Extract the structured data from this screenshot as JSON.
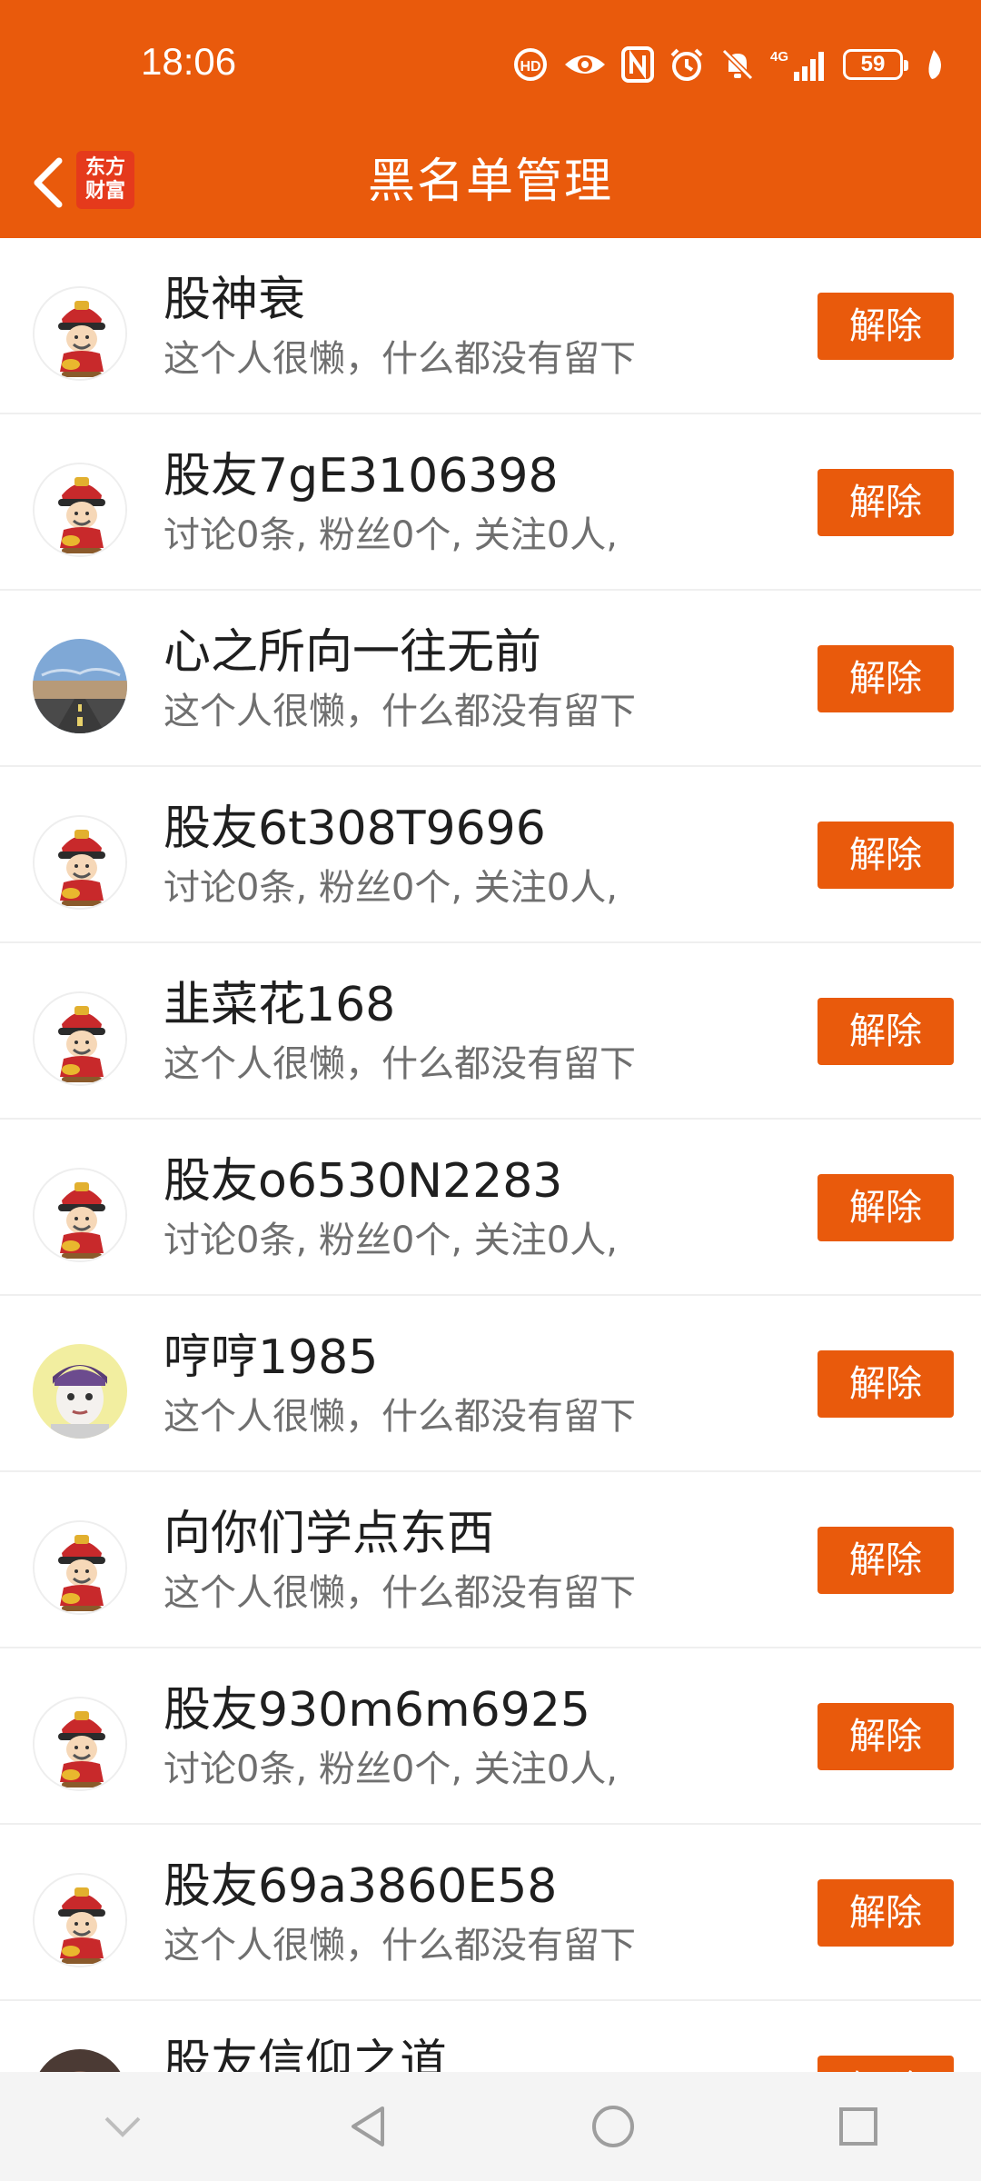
{
  "status_bar": {
    "time": "18:06",
    "battery": "59",
    "icons": [
      "hd-icon",
      "eye-icon",
      "nfc-icon",
      "alarm-icon",
      "mute-icon",
      "signal-4g-icon",
      "battery-icon",
      "leaf-icon"
    ]
  },
  "header": {
    "title": "黑名单管理",
    "logo_line1": "东方",
    "logo_line2": "财富",
    "back_icon": "chevron-left-icon"
  },
  "colors": {
    "brand": "#E95A0C",
    "divider": "#EFEFEF"
  },
  "button_label": "解除",
  "users": [
    {
      "name": "股神衰",
      "desc": "这个人很懒，什么都没有留下",
      "avatar": "caishen-avatar"
    },
    {
      "name": "股友7gE3106398",
      "desc": "讨论0条, 粉丝0个, 关注0人,",
      "avatar": "caishen-avatar"
    },
    {
      "name": "心之所向一往无前",
      "desc": "这个人很懒，什么都没有留下",
      "avatar": "road-photo-avatar"
    },
    {
      "name": "股友6t308T9696",
      "desc": "讨论0条, 粉丝0个, 关注0人,",
      "avatar": "caishen-avatar"
    },
    {
      "name": "韭菜花168",
      "desc": "这个人很懒，什么都没有留下",
      "avatar": "caishen-avatar"
    },
    {
      "name": "股友o6530N2283",
      "desc": "讨论0条, 粉丝0个, 关注0人,",
      "avatar": "caishen-avatar"
    },
    {
      "name": "哼哼1985",
      "desc": "这个人很懒，什么都没有留下",
      "avatar": "cartoon-boy-avatar"
    },
    {
      "name": "向你们学点东西",
      "desc": "这个人很懒，什么都没有留下",
      "avatar": "caishen-avatar"
    },
    {
      "name": "股友930m6m6925",
      "desc": "讨论0条, 粉丝0个, 关注0人,",
      "avatar": "caishen-avatar"
    },
    {
      "name": "股友69a3860E58",
      "desc": "这个人很懒，什么都没有留下",
      "avatar": "caishen-avatar"
    },
    {
      "name": "股友信仰之道",
      "desc": "",
      "avatar": "dark-photo-avatar"
    }
  ],
  "system_nav": {
    "icons": [
      "collapse-chevron-icon",
      "back-triangle-icon",
      "home-circle-icon",
      "recents-square-icon"
    ]
  }
}
